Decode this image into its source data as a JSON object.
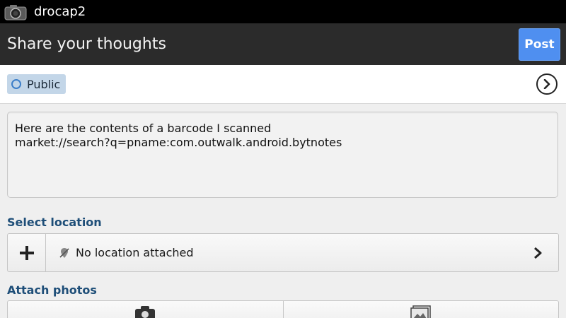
{
  "status_bar": {
    "app_title": "drocap2",
    "app_icon": "camera-icon"
  },
  "action_bar": {
    "title": "Share your thoughts",
    "post_label": "Post",
    "post_color": "#4f8ff0"
  },
  "audience": {
    "label": "Public",
    "icon": "circle-icon",
    "next_icon": "chevron-circle-icon"
  },
  "composer": {
    "text": "Here are the contents of a barcode I scanned\nmarket://search?q=pname:com.outwalk.android.bytnotes"
  },
  "location": {
    "header": "Select location",
    "add_icon": "plus-icon",
    "status_icon": "no-location-icon",
    "label": "No location attached",
    "chevron_icon": "chevron-right-icon"
  },
  "photos": {
    "header": "Attach photos",
    "buttons": [
      {
        "icon": "camera-icon"
      },
      {
        "icon": "gallery-icon"
      }
    ]
  },
  "colors": {
    "section_header": "#1e4e78",
    "chip_bg": "#c3d6e8",
    "action_bar_bg": "#2b2b2b"
  }
}
